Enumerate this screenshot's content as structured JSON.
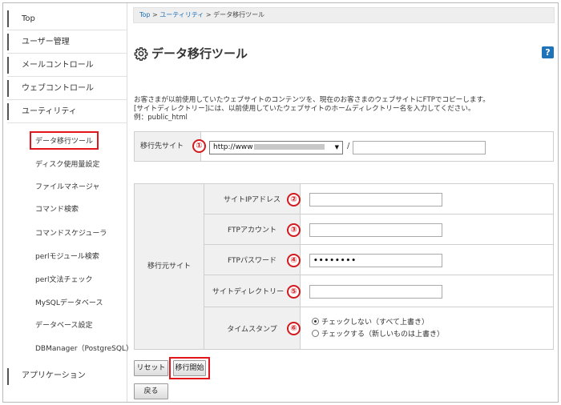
{
  "sidebar": {
    "top_items": [
      {
        "label": "Top"
      },
      {
        "label": "ユーザー管理"
      },
      {
        "label": "メールコントロール"
      },
      {
        "label": "ウェブコントロール"
      },
      {
        "label": "ユーティリティ"
      }
    ],
    "sub_items": [
      {
        "label": "データ移行ツール",
        "active": true
      },
      {
        "label": "ディスク使用量設定"
      },
      {
        "label": "ファイルマネージャ"
      },
      {
        "label": "コマンド検索"
      },
      {
        "label": "コマンドスケジューラ"
      },
      {
        "label": "perlモジュール検索"
      },
      {
        "label": "perl文法チェック"
      },
      {
        "label": "MySQLデータベース"
      },
      {
        "label": "データベース設定"
      },
      {
        "label": "DBManager（PostgreSQL）"
      }
    ],
    "bottom_item": {
      "label": "アプリケーション"
    }
  },
  "breadcrumb": {
    "items": [
      "Top",
      "ユーティリティ",
      "データ移行ツール"
    ],
    "separator": ">"
  },
  "page": {
    "title": "データ移行ツール",
    "help_label": "?",
    "description": [
      "お客さまが以前使用していたウェブサイトのコンテンツを、現在のお客さまのウェブサイトにFTPでコピーします。",
      "[サイトディレクトリー]には、以前使用していたウェブサイトのホームディレクトリー名を入力してください。",
      "例：public_html"
    ]
  },
  "destination": {
    "label": "移行先サイト",
    "marker": "①",
    "protocol_value": "http://www",
    "separator": "/"
  },
  "source": {
    "label": "移行元サイト",
    "rows": [
      {
        "label": "サイトIPアドレス",
        "marker": "②"
      },
      {
        "label": "FTPアカウント",
        "marker": "③"
      },
      {
        "label": "FTPパスワード",
        "marker": "④",
        "value": "••••••••"
      },
      {
        "label": "サイトディレクトリー",
        "marker": "⑤"
      },
      {
        "label": "タイムスタンプ",
        "marker": "⑥"
      }
    ],
    "timestamp_options": [
      {
        "label": "チェックしない（すべて上書き）",
        "selected": true
      },
      {
        "label": "チェックする（新しいものは上書き）",
        "selected": false
      }
    ]
  },
  "buttons": {
    "reset": "リセット",
    "start": "移行開始",
    "back": "戻る"
  },
  "colors": {
    "accent_link": "#1a6fb8",
    "highlight_red": "#e2151b",
    "help_blue": "#1f73b8"
  }
}
